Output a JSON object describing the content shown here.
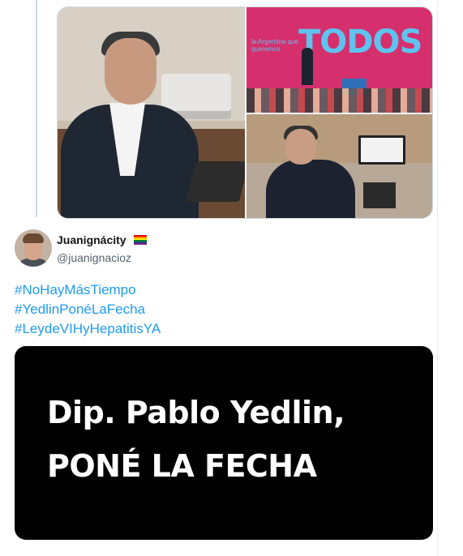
{
  "media": {
    "stage_sign_text": "TODOS",
    "stage_subtitle": "la Argentina que queremos",
    "podium_text": "TODOS"
  },
  "tweet": {
    "display_name": "Juanignácity",
    "handle": "@juanignacioz",
    "flag_colors": [
      "#e40303",
      "#ff8c00",
      "#ffed00",
      "#008026",
      "#24408e",
      "#732982"
    ],
    "hashtags": [
      "#NoHayMásTiempo",
      "#YedlinPonéLaFecha",
      "#LeydeVIHyHepatitisYA"
    ],
    "link_color": "#1d9bf0",
    "image_card": {
      "line1": "Dip. Pablo Yedlin,",
      "line2": "PONÉ LA FECHA"
    }
  }
}
